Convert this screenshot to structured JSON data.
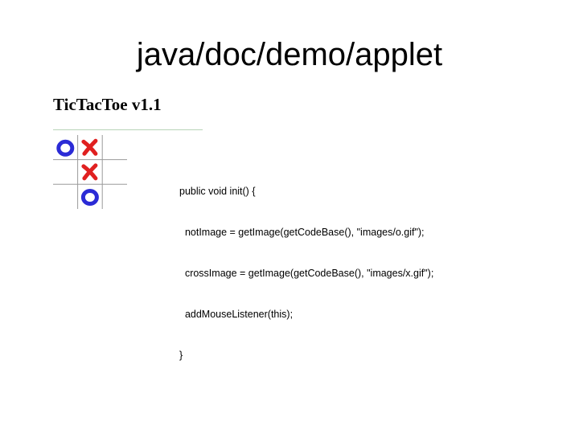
{
  "slide": {
    "title": "java/doc/demo/applet"
  },
  "applet": {
    "title": "TicTacToe v1.1",
    "board": {
      "cells": [
        "o",
        "x",
        "",
        "",
        "x",
        "",
        "",
        "o",
        ""
      ],
      "colors": {
        "o": "#2b2bd6",
        "x": "#e02020",
        "grid": "#9a9a9a"
      }
    }
  },
  "code": {
    "lines": [
      "public void init() {",
      "  notImage = getImage(getCodeBase(), \"images/o.gif\");",
      "  crossImage = getImage(getCodeBase(), \"images/x.gif\");",
      "  addMouseListener(this);",
      "}"
    ]
  }
}
